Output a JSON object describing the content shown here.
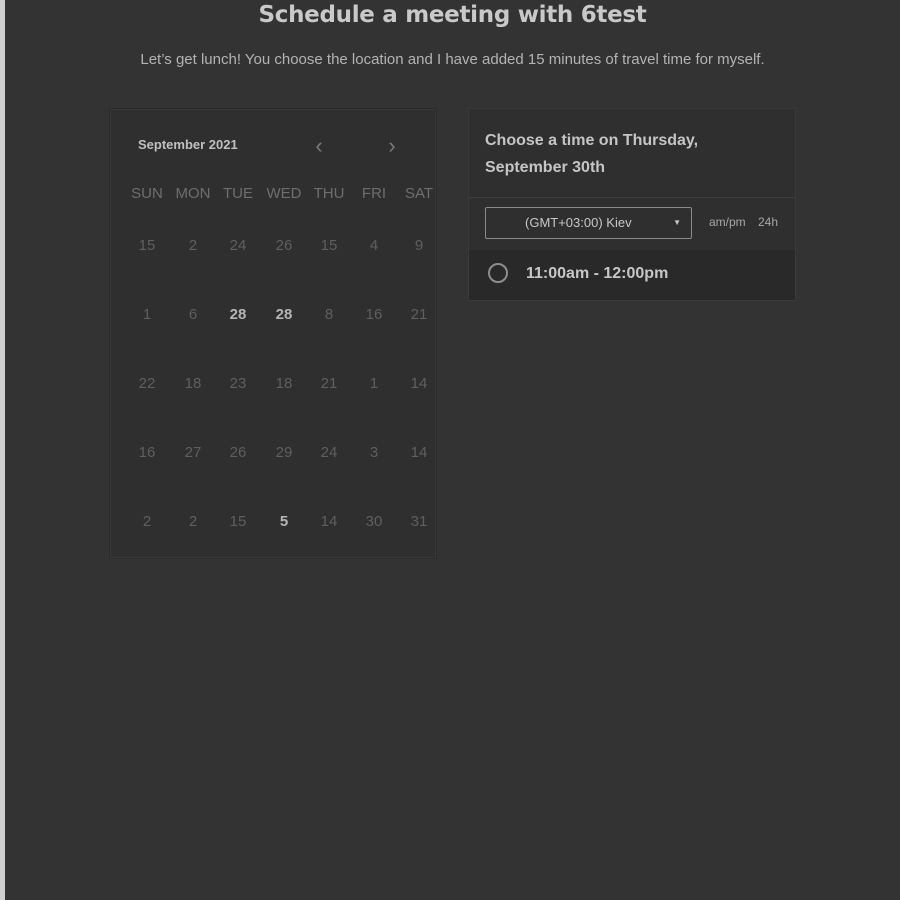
{
  "header": {
    "title": "Schedule a meeting with 6test",
    "subtitle": "Let’s get lunch! You choose the location and I have added 15 minutes of travel time for myself."
  },
  "calendar": {
    "month_label": "September 2021",
    "prev_icon": "‹",
    "next_icon": "›",
    "weekdays": [
      "SUN",
      "MON",
      "TUE",
      "WED",
      "THU",
      "FRI",
      "SAT"
    ],
    "weeks": [
      [
        {
          "d": "15",
          "available": false
        },
        {
          "d": "2",
          "available": false
        },
        {
          "d": "24",
          "available": false
        },
        {
          "d": "26",
          "available": false
        },
        {
          "d": "15",
          "available": false
        },
        {
          "d": "4",
          "available": false
        },
        {
          "d": "9",
          "available": false
        }
      ],
      [
        {
          "d": "1",
          "available": false
        },
        {
          "d": "6",
          "available": false
        },
        {
          "d": "28",
          "available": true
        },
        {
          "d": "28",
          "available": true
        },
        {
          "d": "8",
          "available": false
        },
        {
          "d": "16",
          "available": false
        },
        {
          "d": "21",
          "available": false
        }
      ],
      [
        {
          "d": "22",
          "available": false
        },
        {
          "d": "18",
          "available": false
        },
        {
          "d": "23",
          "available": false
        },
        {
          "d": "18",
          "available": false
        },
        {
          "d": "21",
          "available": false
        },
        {
          "d": "1",
          "available": false
        },
        {
          "d": "14",
          "available": false
        }
      ],
      [
        {
          "d": "16",
          "available": false
        },
        {
          "d": "27",
          "available": false
        },
        {
          "d": "26",
          "available": false
        },
        {
          "d": "29",
          "available": false
        },
        {
          "d": "24",
          "available": false
        },
        {
          "d": "3",
          "available": false
        },
        {
          "d": "14",
          "available": false
        }
      ],
      [
        {
          "d": "2",
          "available": false
        },
        {
          "d": "2",
          "available": false
        },
        {
          "d": "15",
          "available": false
        },
        {
          "d": "5",
          "available": true
        },
        {
          "d": "14",
          "available": false
        },
        {
          "d": "30",
          "available": false
        },
        {
          "d": "31",
          "available": false
        }
      ]
    ]
  },
  "time_picker": {
    "heading": "Choose a time on Thursday, September 30th",
    "timezone": "(GMT+03:00) Kiev",
    "caret_icon": "▼",
    "ampm_label": "am/pm",
    "h24_label": "24h",
    "slots": [
      {
        "label": "11:00am - 12:00pm"
      }
    ]
  }
}
